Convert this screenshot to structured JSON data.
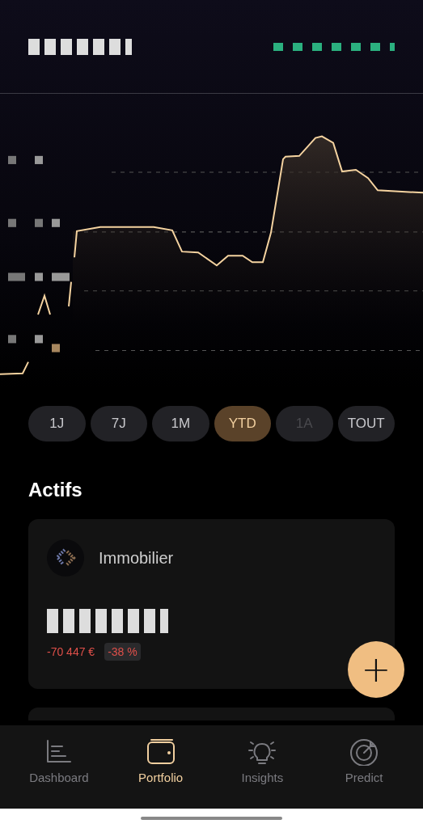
{
  "periods": [
    {
      "label": "1J",
      "selected": false,
      "disabled": false
    },
    {
      "label": "7J",
      "selected": false,
      "disabled": false
    },
    {
      "label": "1M",
      "selected": false,
      "disabled": false
    },
    {
      "label": "YTD",
      "selected": true,
      "disabled": false
    },
    {
      "label": "1A",
      "selected": false,
      "disabled": true
    },
    {
      "label": "TOUT",
      "selected": false,
      "disabled": false
    }
  ],
  "assets_title": "Actifs",
  "assets": [
    {
      "name": "Immobilier",
      "change": "-70 447 €",
      "change_percent": "-38 %"
    }
  ],
  "add_button": {
    "label": "+"
  },
  "nav": [
    {
      "label": "Dashboard",
      "kind": "bars",
      "selected": false
    },
    {
      "label": "Portfolio",
      "kind": "wallet",
      "selected": true
    },
    {
      "label": "Insights",
      "kind": "bulb",
      "selected": false
    },
    {
      "label": "Predict",
      "kind": "target",
      "selected": false
    }
  ]
}
